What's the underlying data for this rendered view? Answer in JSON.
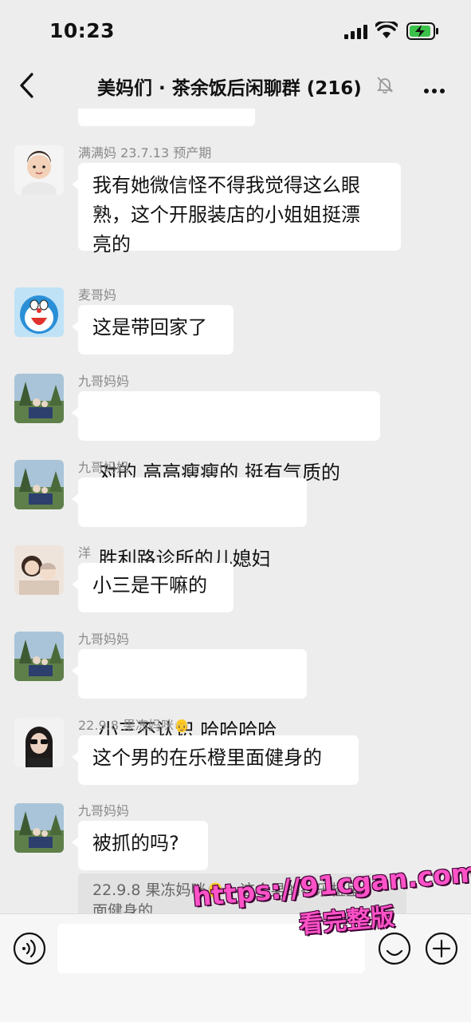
{
  "status_bar": {
    "time": "10:23"
  },
  "header": {
    "title": "美妈们 · 茶余饭后闲聊群 (216)",
    "icons": [
      "back-chevron-icon",
      "muted-bell-icon",
      "more-dots-icon"
    ]
  },
  "messages": [
    {
      "sender": "满满妈 23.7.13 预产期",
      "lines": [
        "我有她微信怪不得我觉得这么眼",
        "熟，这个开服装店的小姐姐挺漂",
        "亮的"
      ],
      "avatar": "baby-avatar"
    },
    {
      "sender": "麦哥妈",
      "lines": [
        "这是带回家了"
      ],
      "avatar": "doraemon-avatar"
    },
    {
      "sender": "九哥妈妈",
      "lines": [
        " 对的 高高瘦瘦的 挺有气质的"
      ],
      "avatar": "scenery-avatar"
    },
    {
      "sender": "九哥妈妈",
      "lines": [
        " 胜利路诊所的儿媳妇"
      ],
      "avatar": "scenery-avatar"
    },
    {
      "sender": "洋",
      "lines": [
        "小三是干嘛的"
      ],
      "avatar": "mother-child-avatar"
    },
    {
      "sender": "九哥妈妈",
      "lines": [
        " 小三不认识 哈哈哈哈"
      ],
      "avatar": "scenery-avatar"
    },
    {
      "sender": "22.9.8 果冻妈咪👴",
      "lines": [
        "这个男的在乐橙里面健身的"
      ],
      "avatar": "sunglasses-woman-avatar"
    },
    {
      "sender": "九哥妈妈",
      "lines": [
        "被抓的吗?"
      ],
      "avatar": "scenery-avatar"
    }
  ],
  "quote": {
    "line1": "22.9.8 果冻妈咪👴：这个男的在乐橙里",
    "line2": "面健身的"
  },
  "input_bar": {
    "value": "",
    "icons": [
      "voice-icon",
      "emoji-icon",
      "plus-icon"
    ]
  },
  "watermark": {
    "url": "https://91cgan.com",
    "text": "看完整版"
  },
  "colors": {
    "background": "#ededed",
    "bubble": "#ffffff",
    "sender_text": "#8a8a8a",
    "watermark": "#ff52c8"
  }
}
